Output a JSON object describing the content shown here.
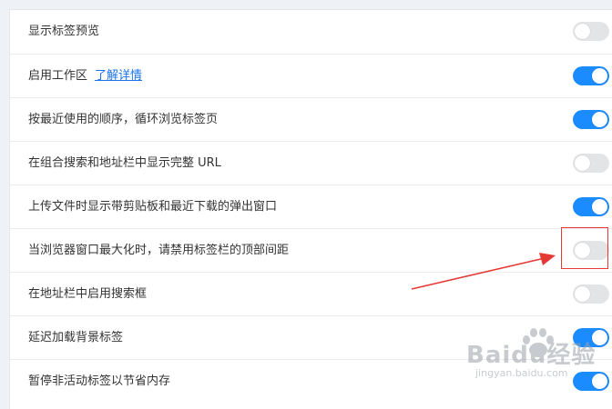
{
  "settings": {
    "items": [
      {
        "label": "显示标签预览",
        "enabled": false
      },
      {
        "label": "启用工作区",
        "link": "了解详情",
        "enabled": true
      },
      {
        "label": "按最近使用的顺序，循环浏览标签页",
        "enabled": true
      },
      {
        "label": "在组合搜索和地址栏中显示完整 URL",
        "enabled": false
      },
      {
        "label": "上传文件时显示带剪贴板和最近下载的弹出窗口",
        "enabled": true
      },
      {
        "label": "当浏览器窗口最大化时，请禁用标签栏的顶部间距",
        "enabled": false
      },
      {
        "label": "在地址栏中启用搜索框",
        "enabled": false
      },
      {
        "label": "延迟加载背景标签",
        "enabled": true
      },
      {
        "label": "暂停非活动标签以节省内存",
        "enabled": true
      }
    ]
  },
  "colors": {
    "toggle_on": "#1a8cff",
    "toggle_off": "#e3e4e6",
    "annotation": "#e53935"
  },
  "watermark": {
    "text": "Baidu经验",
    "subtext": "jingyan.baidu.com"
  }
}
